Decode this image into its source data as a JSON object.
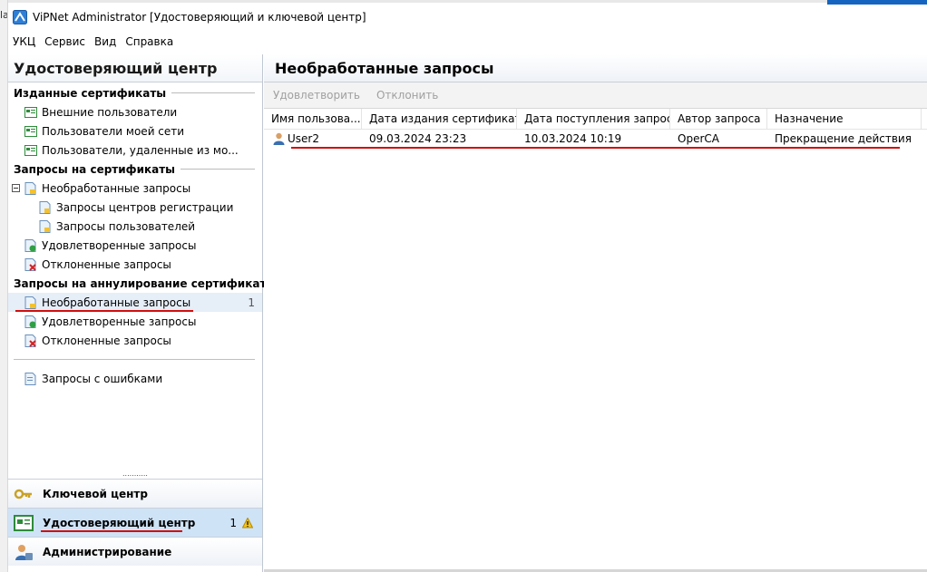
{
  "window": {
    "title": "ViPNet Administrator [Удостоверяющий и ключевой центр]",
    "left_fragment": "la"
  },
  "menu": [
    "УКЦ",
    "Сервис",
    "Вид",
    "Справка"
  ],
  "left_panel": {
    "title": "Удостоверяющий центр",
    "groups": [
      {
        "label": "Изданные сертификаты",
        "items": [
          {
            "label": "Внешние пользователи",
            "icon": "cert-card-icon"
          },
          {
            "label": "Пользователи моей сети",
            "icon": "cert-card-icon"
          },
          {
            "label": "Пользователи, удаленные из мо...",
            "icon": "cert-card-icon"
          }
        ]
      },
      {
        "label": "Запросы на сертификаты",
        "items": [
          {
            "label": "Необработанные запросы",
            "icon": "request-doc-icon",
            "expanded": true
          },
          {
            "label": "Запросы центров регистрации",
            "icon": "request-doc-icon",
            "child": true
          },
          {
            "label": "Запросы пользователей",
            "icon": "request-doc-icon",
            "child": true
          },
          {
            "label": "Удовлетворенные запросы",
            "icon": "approved-doc-icon"
          },
          {
            "label": "Отклоненные запросы",
            "icon": "rejected-doc-icon"
          }
        ]
      },
      {
        "label": "Запросы на аннулирование сертификатов",
        "count": "1",
        "items": [
          {
            "label": "Необработанные запросы",
            "icon": "request-doc-icon",
            "count": "1",
            "selected": true
          },
          {
            "label": "Удовлетворенные запросы",
            "icon": "approved-doc-icon"
          },
          {
            "label": "Отклоненные запросы",
            "icon": "rejected-doc-icon"
          }
        ]
      }
    ],
    "error_requests": "Запросы с ошибками",
    "grip": "...........",
    "nav": [
      {
        "label": "Ключевой центр",
        "icon": "keys-icon"
      },
      {
        "label": "Удостоверяющий центр",
        "icon": "certificate-center-icon",
        "count": "1",
        "active": true
      },
      {
        "label": "Администрирование",
        "icon": "admin-user-icon"
      }
    ]
  },
  "right_panel": {
    "title": "Необработанные запросы",
    "toolbar": [
      "Удовлетворить",
      "Отклонить"
    ],
    "columns": [
      "Имя пользова...",
      "Дата издания сертификата",
      "Дата поступления запроса",
      "Автор запроса",
      "Назначение"
    ],
    "rows": [
      [
        "User2",
        "09.03.2024 23:23",
        "10.03.2024 10:19",
        "OperCA",
        "Прекращение действия"
      ]
    ]
  },
  "colors": {
    "accent_underline": "#d10f0f",
    "nav_active": "#cfe3f7",
    "disabled_text": "#a0a0a0"
  }
}
